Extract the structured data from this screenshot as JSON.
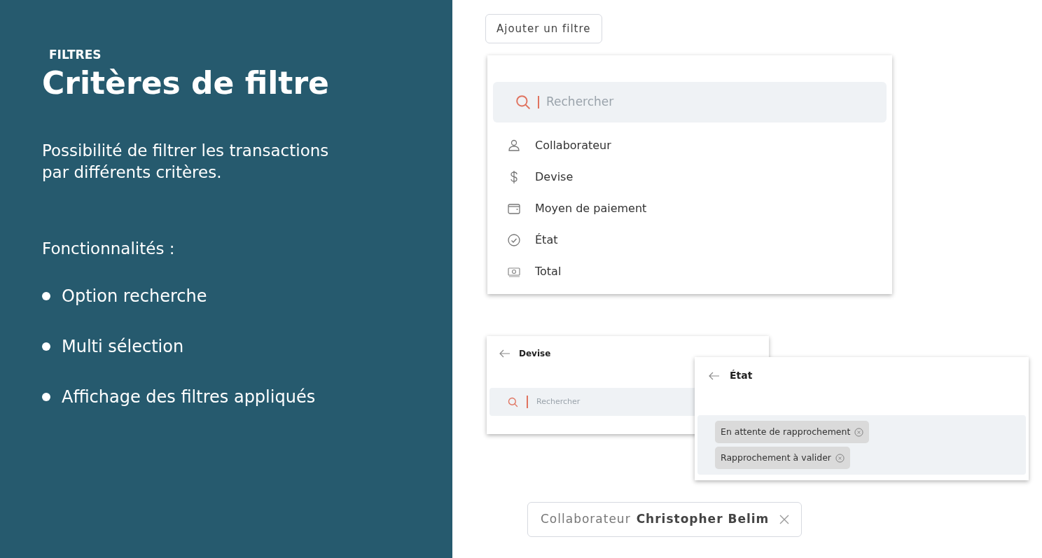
{
  "sidebar": {
    "eyebrow": "FILTRES",
    "title": "Critères de filtre",
    "description": "Possibilité de filtrer les transactions par différents critères.",
    "features_heading": "Fonctionnalités :",
    "features": [
      "Option recherche",
      "Multi sélection",
      "Affichage des filtres appliqués"
    ]
  },
  "add_filter_button": "Ajouter un filtre",
  "filter_menu": {
    "search": {
      "placeholder": "Rechercher"
    },
    "items": [
      {
        "kind": "person",
        "label": "Collaborateur"
      },
      {
        "kind": "dollar",
        "label": "Devise"
      },
      {
        "kind": "wallet",
        "label": "Moyen de paiement"
      },
      {
        "kind": "check",
        "label": "État"
      },
      {
        "kind": "money",
        "label": "Total"
      }
    ]
  },
  "devise_panel": {
    "title": "Devise",
    "search": {
      "placeholder": "Rechercher"
    }
  },
  "etat_panel": {
    "title": "État",
    "chips": [
      "En attente de rapprochement",
      "Rapprochement à valider"
    ]
  },
  "applied_filter": {
    "field": "Collaborateur",
    "value": "Christopher Belim"
  }
}
